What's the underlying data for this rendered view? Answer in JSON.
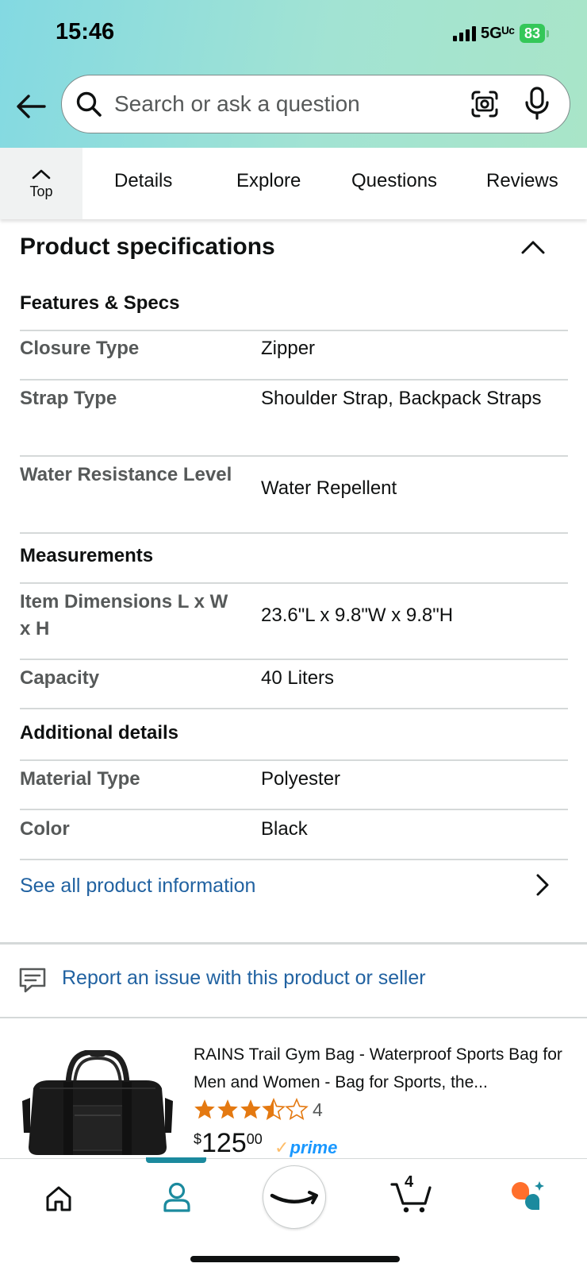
{
  "status_bar": {
    "time": "15:46",
    "network": "5Gᵁᶜ",
    "battery": "83"
  },
  "search": {
    "placeholder": "Search or ask a question"
  },
  "tabs": {
    "top_label": "Top",
    "items": [
      "Details",
      "Explore",
      "Questions",
      "Reviews"
    ]
  },
  "specs": {
    "title": "Product specifications",
    "sections": [
      {
        "heading": "Features & Specs",
        "rows": [
          {
            "label": "Closure Type",
            "value": "Zipper"
          },
          {
            "label": "Strap Type",
            "value": "Shoulder Strap, Backpack Straps"
          },
          {
            "label": "Water Resistance Level",
            "value": "Water Repellent"
          }
        ]
      },
      {
        "heading": "Measurements",
        "rows": [
          {
            "label": "Item Dimensions L x W x H",
            "value": "23.6\"L x 9.8\"W x 9.8\"H"
          },
          {
            "label": "Capacity",
            "value": "40 Liters"
          }
        ]
      },
      {
        "heading": "Additional details",
        "rows": [
          {
            "label": "Material Type",
            "value": "Polyester"
          },
          {
            "label": "Color",
            "value": "Black"
          }
        ]
      }
    ],
    "see_all": "See all product information"
  },
  "report": {
    "link": "Report an issue with this product or seller"
  },
  "product_card": {
    "title": "RAINS Trail Gym Bag - Waterproof Sports Bag for Men and Women - Bag for Sports, the...",
    "rating": 3.5,
    "rating_count": "4",
    "price_symbol": "$",
    "price_whole": "125",
    "price_fraction": "00",
    "prime_label": "prime",
    "prime_check": "✓"
  },
  "bottom_nav": {
    "cart_count": "4",
    "active": "account"
  },
  "colors": {
    "link": "#2162a1",
    "star": "#e47911",
    "prime": "#1a98ff",
    "active_tab": "#1b8a9e"
  }
}
